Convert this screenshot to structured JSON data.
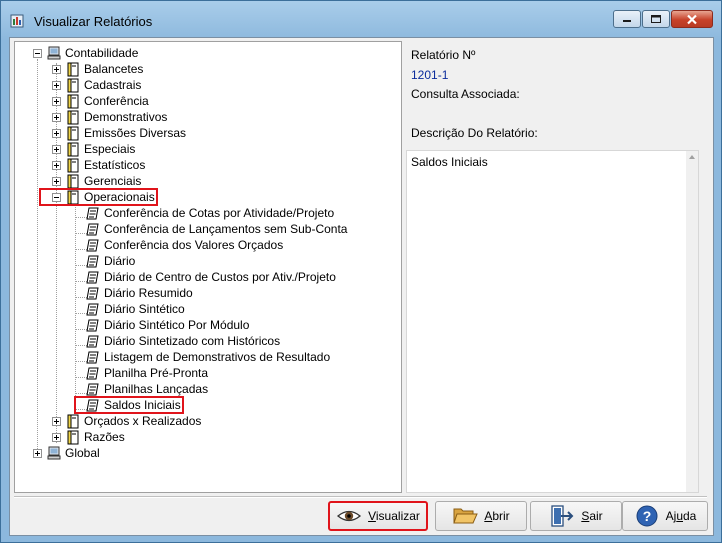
{
  "window": {
    "title": "Visualizar Relatórios"
  },
  "tree": {
    "root": {
      "label": "Contabilidade",
      "expanded": true
    },
    "groups_top": [
      {
        "label": "Balancetes"
      },
      {
        "label": "Cadastrais"
      },
      {
        "label": "Conferência"
      },
      {
        "label": "Demonstrativos"
      },
      {
        "label": "Emissões Diversas"
      },
      {
        "label": "Especiais"
      },
      {
        "label": "Estatísticos"
      },
      {
        "label": "Gerenciais"
      }
    ],
    "open_group": {
      "label": "Operacionais",
      "expanded": true
    },
    "reports": [
      {
        "label": "Conferência de Cotas por Atividade/Projeto"
      },
      {
        "label": "Conferência de Lançamentos sem Sub-Conta"
      },
      {
        "label": "Conferência dos Valores Orçados"
      },
      {
        "label": "Diário"
      },
      {
        "label": "Diário de Centro de Custos por Ativ./Projeto"
      },
      {
        "label": "Diário Resumido"
      },
      {
        "label": "Diário Sintético"
      },
      {
        "label": "Diário Sintético Por Módulo"
      },
      {
        "label": "Diário Sintetizado com Históricos"
      },
      {
        "label": "Listagem de Demonstrativos de Resultado"
      },
      {
        "label": "Planilha Pré-Pronta"
      },
      {
        "label": "Planilhas Lançadas"
      },
      {
        "label": "Saldos Iniciais",
        "selected": true
      }
    ],
    "groups_bottom": [
      {
        "label": "Orçados x Realizados"
      },
      {
        "label": "Razões"
      }
    ],
    "root2": {
      "label": "Global",
      "expanded": false
    }
  },
  "details": {
    "report_no_label": "Relatório Nº",
    "report_no_value": "1201-1",
    "query_label": "Consulta Associada:",
    "description_label": "Descrição Do Relatório:",
    "description_text": "Saldos Iniciais"
  },
  "buttons": {
    "visualizar": {
      "label_pre": "",
      "label_ul": "V",
      "label_post": "isualizar"
    },
    "abrir": {
      "label_pre": "",
      "label_ul": "A",
      "label_post": "brir"
    },
    "sair": {
      "label_pre": "",
      "label_ul": "S",
      "label_post": "air"
    },
    "ajuda": {
      "label_pre": "Aj",
      "label_ul": "u",
      "label_post": "da"
    }
  },
  "colors": {
    "highlight_red": "#e0141b",
    "value_blue": "#0b2c9c",
    "titlebar": "#8cb8dd"
  },
  "icons": {
    "app": "report-window-icon",
    "root": "computer-icon",
    "group": "report-book-icon",
    "report": "report-page-icon",
    "visualizar": "eye-icon",
    "abrir": "folder-open-icon",
    "sair": "exit-door-icon",
    "ajuda": "help-icon"
  }
}
